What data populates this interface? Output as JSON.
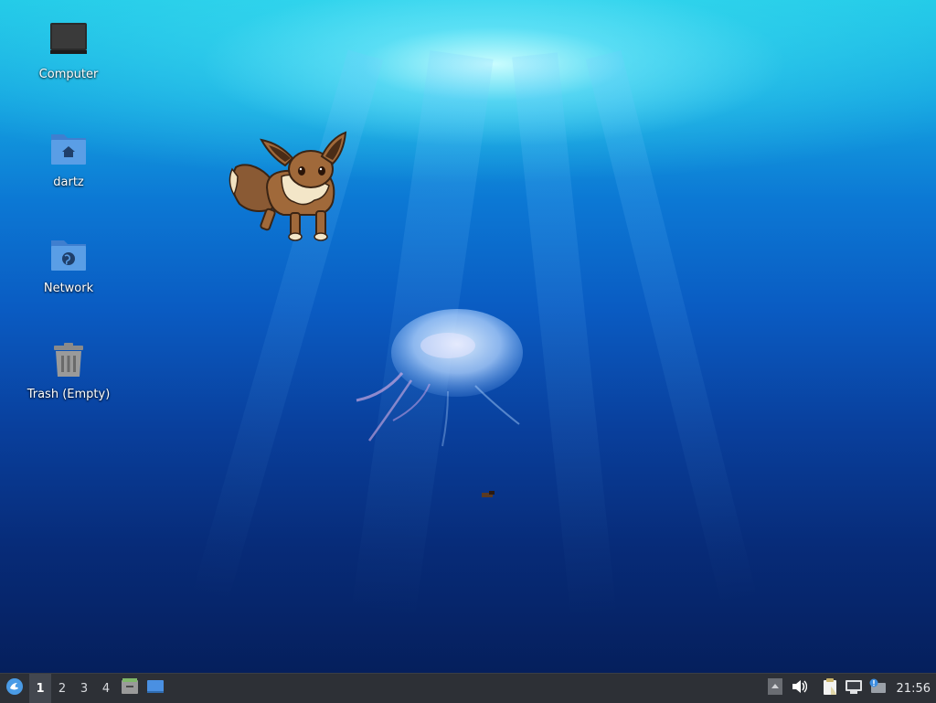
{
  "desktop": {
    "icons": [
      {
        "label": "Computer",
        "icon": "computer-icon"
      },
      {
        "label": "dartz",
        "icon": "home-folder-icon"
      },
      {
        "label": "Network",
        "icon": "network-folder-icon"
      },
      {
        "label": "Trash (Empty)",
        "icon": "trash-icon"
      }
    ],
    "wallpaper": "jellyfish-underwater",
    "overlay_sprite": "eevee-sprite"
  },
  "taskbar": {
    "menu_icon": "xfce-menu-icon",
    "workspaces": [
      "1",
      "2",
      "3",
      "4"
    ],
    "active_workspace": "1",
    "launchers": [
      {
        "icon": "file-manager-icon"
      },
      {
        "icon": "show-desktop-icon"
      }
    ],
    "tray": [
      {
        "icon": "tray-expand-icon"
      },
      {
        "icon": "volume-icon"
      },
      {
        "icon": "clipboard-icon"
      },
      {
        "icon": "network-wired-icon"
      },
      {
        "icon": "notification-update-icon"
      }
    ],
    "clock": "21:56"
  },
  "colors": {
    "taskbar_bg": "#2d3036",
    "active_workspace_bg": "#43474f",
    "folder_blue": "#5a9ee6"
  }
}
